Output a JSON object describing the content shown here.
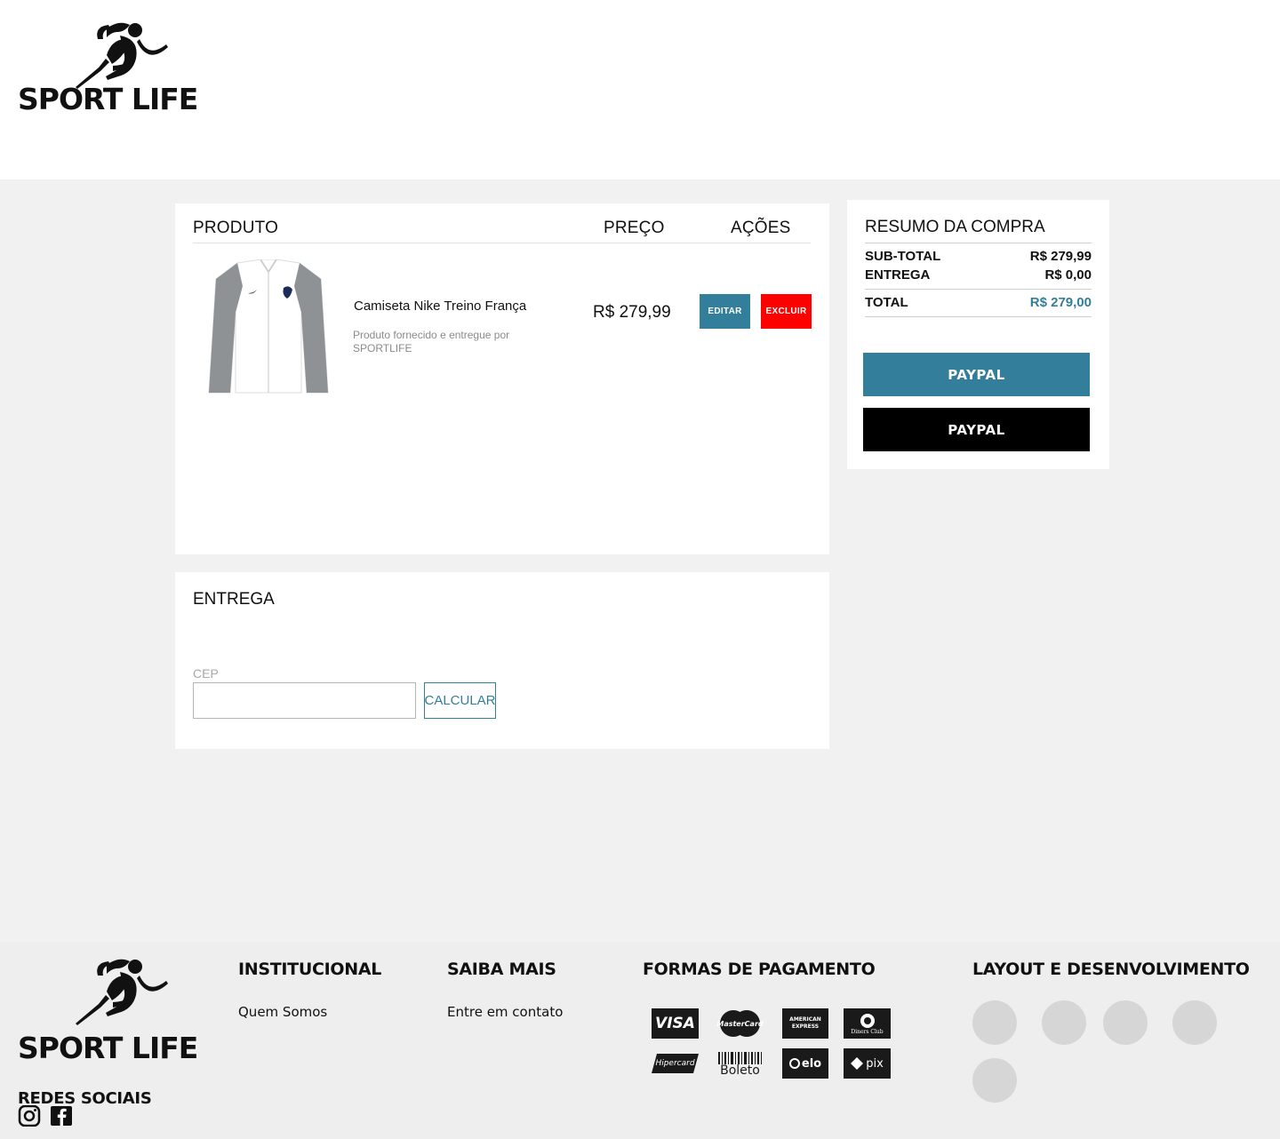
{
  "brand": {
    "name": "SPORT LIFE"
  },
  "cart": {
    "headers": {
      "product": "PRODUTO",
      "price": "PREÇO",
      "actions": "AÇÕES"
    },
    "items": [
      {
        "name": "Camiseta Nike Treino França",
        "subtitle": "Produto fornecido e entregue por SPORTLIFE",
        "price": "R$ 279,99",
        "edit_label": "EDITAR",
        "delete_label": "EXCLUIR"
      }
    ]
  },
  "summary": {
    "title": "RESUMO DA COMPRA",
    "subtotal_label": "SUB-TOTAL",
    "subtotal_value": "R$ 279,99",
    "shipping_label": "ENTREGA",
    "shipping_value": "R$ 0,00",
    "total_label": "TOTAL",
    "total_value": "R$ 279,00",
    "pay_buttons": [
      "PAYPAL",
      "PAYPAL"
    ]
  },
  "shipping": {
    "title": "ENTREGA",
    "cep_label": "CEP",
    "cep_value": "",
    "calc_label": "CALCULAR"
  },
  "footer": {
    "social_title": "REDES SOCIAIS",
    "social_icons": [
      "instagram-icon",
      "facebook-icon"
    ],
    "institutional": {
      "title": "INSTITUCIONAL",
      "links": [
        "Quem Somos"
      ]
    },
    "learn_more": {
      "title": "SAIBA MAIS",
      "links": [
        "Entre em contato"
      ]
    },
    "payments": {
      "title": "FORMAS DE PAGAMENTO",
      "methods": [
        "VISA",
        "MasterCard",
        "AMERICAN EXPRESS",
        "Diners Club",
        "Hipercard",
        "Boleto",
        "elo",
        "pix"
      ]
    },
    "dev": {
      "title": "LAYOUT E DESENVOLVIMENTO"
    }
  },
  "colors": {
    "accent": "#337e9a",
    "danger": "#ff0000",
    "page_bg": "#f2f1f1",
    "footer_bg": "#efeeee",
    "black": "#000000"
  }
}
